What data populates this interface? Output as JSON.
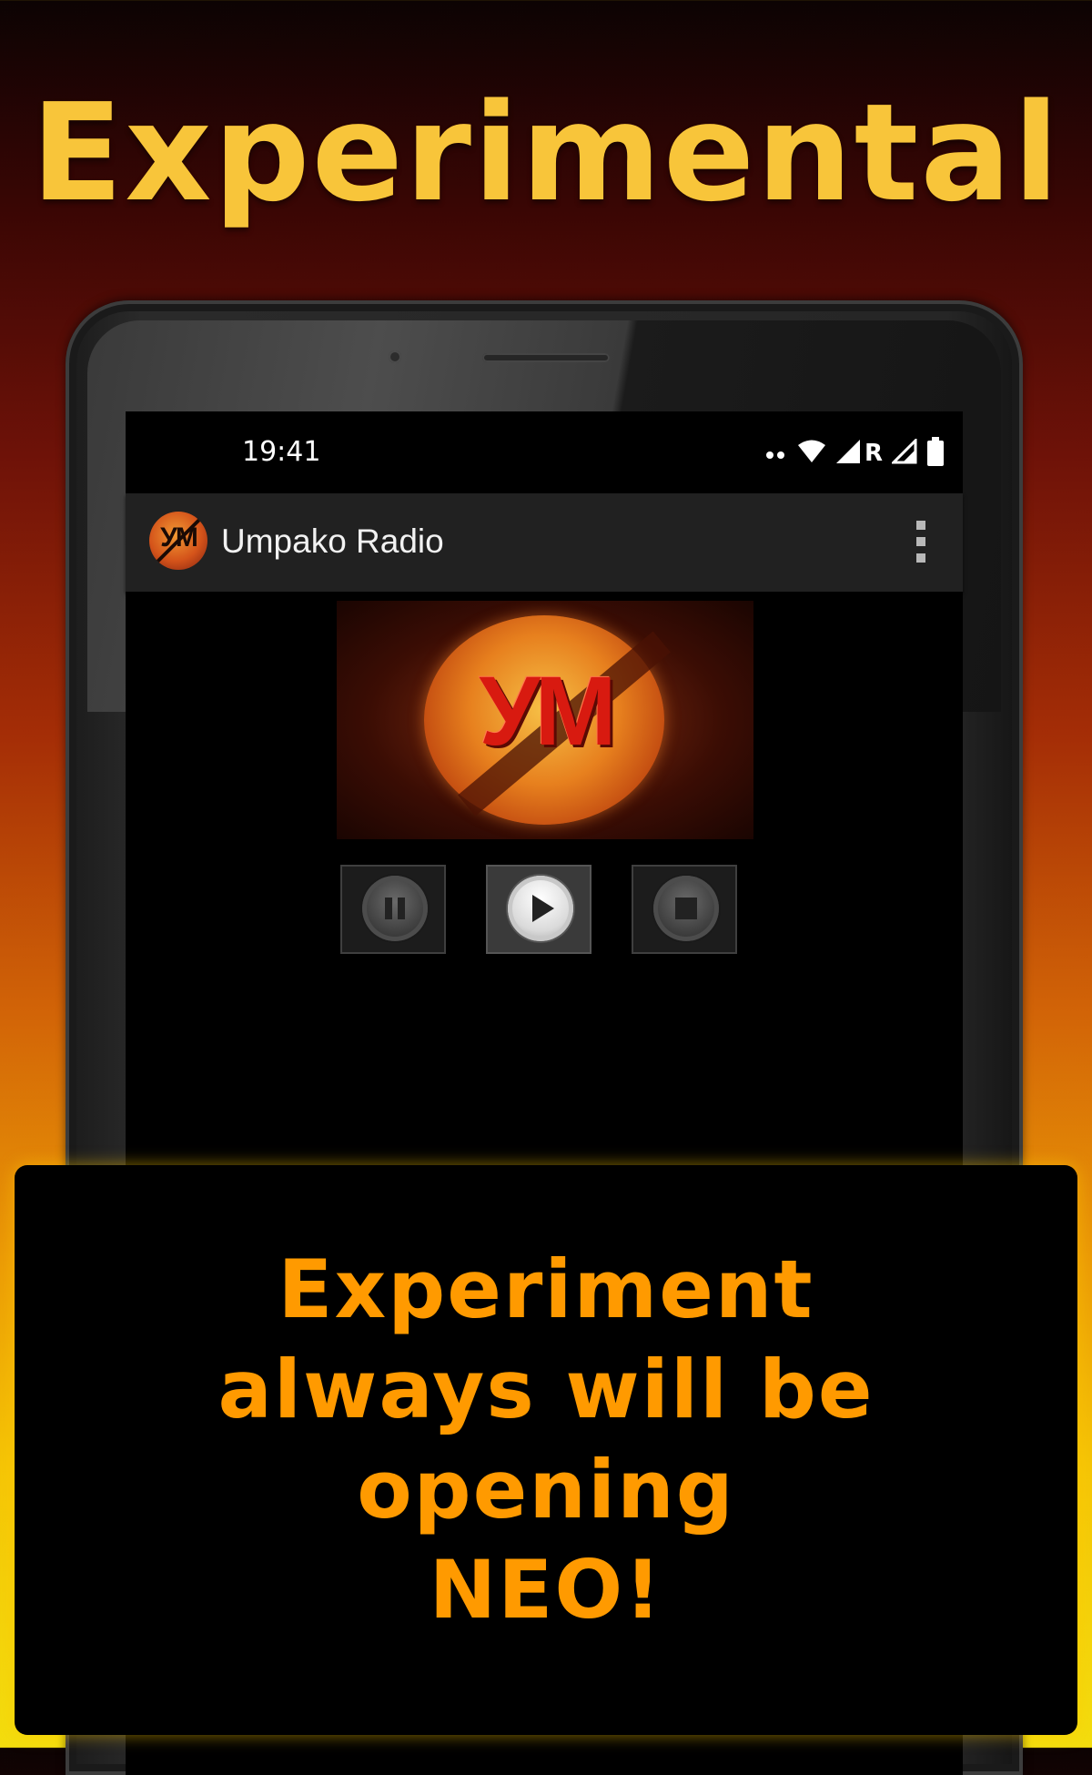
{
  "headline": "Experimental",
  "status_bar": {
    "time": "19:41",
    "roaming": "R",
    "icons": [
      "notification-dots-icon",
      "wifi-icon",
      "signal-icon",
      "signal-outline-icon",
      "battery-icon"
    ]
  },
  "app_bar": {
    "logo_text": "УМ",
    "title": "Umpako Radio",
    "menu_icon": "overflow-menu-icon"
  },
  "banner": {
    "text": "УМ"
  },
  "controls": {
    "pause": "pause-icon",
    "play": "play-icon",
    "stop": "stop-icon"
  },
  "caption": {
    "line1": "Experiment",
    "line2": "always will be",
    "line3": "opening",
    "line4": "NEO!"
  },
  "colors": {
    "headline": "#f8c53a",
    "caption": "#ff9a00",
    "app_bar": "#212121"
  }
}
